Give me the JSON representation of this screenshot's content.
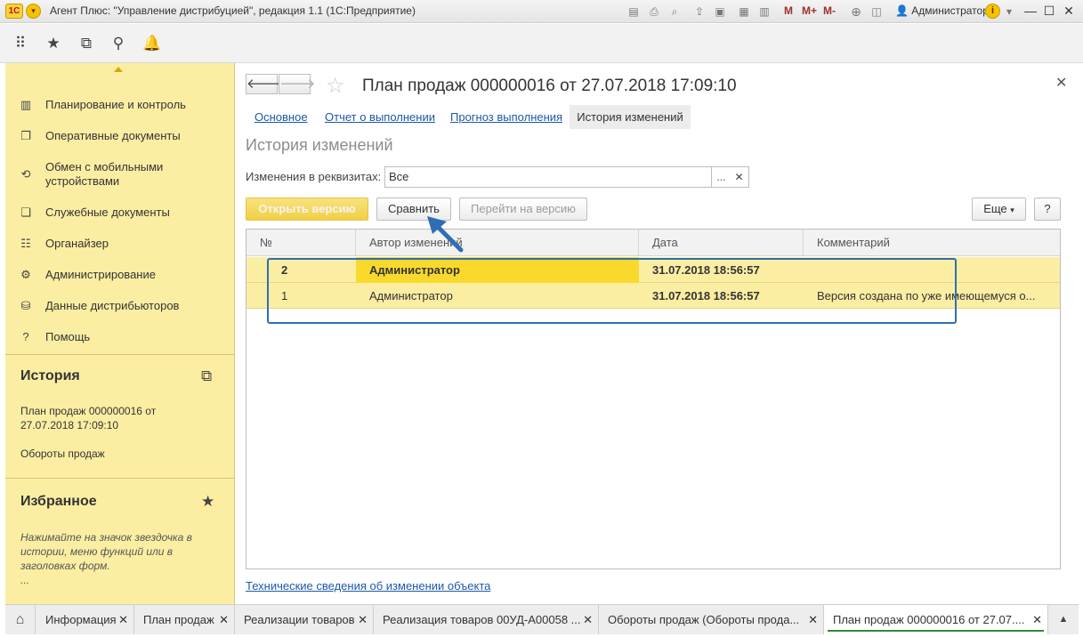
{
  "window": {
    "logo": "1С",
    "title": "Агент Плюс: \"Управление дистрибуцией\", редакция 1.1  (1С:Предприятие)",
    "m_labels": [
      "M",
      "M+",
      "M-"
    ],
    "user": "Администратор",
    "minimize": "—",
    "maximize": "☐",
    "close": "✕"
  },
  "sidebar": {
    "items": [
      {
        "label": "Планирование и контроль",
        "icon": "chart-icon"
      },
      {
        "label": "Оперативные документы",
        "icon": "documents-icon"
      },
      {
        "label": "Обмен с мобильными устройствами",
        "icon": "sync-icon"
      },
      {
        "label": "Служебные документы",
        "icon": "service-documents-icon"
      },
      {
        "label": "Органайзер",
        "icon": "organizer-icon"
      },
      {
        "label": "Администрирование",
        "icon": "gear-icon"
      },
      {
        "label": "Данные дистрибьюторов",
        "icon": "distributor-icon"
      },
      {
        "label": "Помощь",
        "icon": "help-icon"
      }
    ],
    "history": {
      "title": "История",
      "items": [
        "План продаж 000000016 от 27.07.2018 17:09:10",
        "Обороты продаж"
      ]
    },
    "favorites": {
      "title": "Избранное",
      "hint": "Нажимайте на значок звездочка в истории, меню функций или в заголовках форм.",
      "more": "..."
    }
  },
  "form": {
    "title": "План продаж 000000016 от 27.07.2018 17:09:10",
    "tabs": [
      {
        "label": "Основное"
      },
      {
        "label": "Отчет о выполнении"
      },
      {
        "label": "Прогноз выполнения"
      }
    ],
    "active_tab": "История изменений",
    "section_title": "История изменений",
    "filter": {
      "label": "Изменения в реквизитах:",
      "value": "Все"
    },
    "buttons": {
      "open_version": "Открыть версию",
      "compare": "Сравнить",
      "goto_version": "Перейти на версию",
      "more": "Еще",
      "help": "?"
    },
    "table": {
      "columns": [
        "№",
        "Автор изменений",
        "Дата",
        "Комментарий"
      ],
      "rows": [
        {
          "num": "2",
          "author": "Администратор",
          "date": "31.07.2018 18:56:57",
          "comment": ""
        },
        {
          "num": "1",
          "author": "Администратор",
          "date": "31.07.2018 18:56:57",
          "comment": "Версия создана по уже имеющемуся о..."
        }
      ]
    },
    "footer_link": "Технические сведения об изменении объекта"
  },
  "bottom_tabs": [
    {
      "label": "Информация"
    },
    {
      "label": "План продаж"
    },
    {
      "label": "Реализации товаров"
    },
    {
      "label": "Реализация товаров 00УД-А00058 ..."
    },
    {
      "label": "Обороты продаж (Обороты прода..."
    },
    {
      "label": "План продаж 000000016 от 27.07...."
    }
  ],
  "colors": {
    "sidebar_bg": "#fbeea3",
    "row_highlight": "#f9da2c",
    "link": "#1c58a8",
    "annotation": "#2f6eb4"
  }
}
